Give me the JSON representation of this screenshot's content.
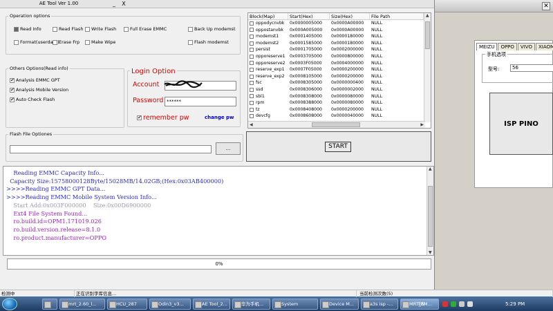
{
  "window": {
    "title": "AE Tool Ver 1.00",
    "minimize": "_",
    "close": "X"
  },
  "operation_options": {
    "legend": "Operation options",
    "items": [
      {
        "label": "Read Info",
        "state": "filled"
      },
      {
        "label": "Read Flash",
        "state": "unchecked"
      },
      {
        "label": "Write Flash",
        "state": "unchecked"
      },
      {
        "label": "Full Erase EMMC",
        "state": "unchecked"
      },
      {
        "label": "Back Up modemst",
        "state": "unchecked"
      },
      {
        "label": "Format(userdata)",
        "state": "unchecked"
      },
      {
        "label": "Erase Frp",
        "state": "unchecked"
      },
      {
        "label": "Make Wipe",
        "state": "unchecked"
      },
      {
        "label": "Flash modemst",
        "state": "unchecked"
      }
    ]
  },
  "other_options": {
    "legend": "Others Options(Read info)",
    "items": [
      {
        "label": "Analysis EMMC GPT",
        "checked": true
      },
      {
        "label": "Analysis Mobile Version",
        "checked": true
      },
      {
        "label": "Auto Check Flash",
        "checked": true
      }
    ]
  },
  "login": {
    "title": "Login Option",
    "account_label": "Account",
    "account_value": "",
    "password_label": "Password",
    "password_value": "******",
    "remember_label": "remember pw",
    "remember_checked": true,
    "change_pw": "change pw"
  },
  "flash_file": {
    "legend": "Flash File Optiones",
    "path_value": "",
    "browse_label": "..."
  },
  "table": {
    "headers": [
      "Block(Map)",
      "Start(Hex)",
      "Size(Hex)",
      "File Path"
    ],
    "rows": [
      [
        "oppodycnvbk",
        "0x0000005000",
        "0x0000A00000",
        "NULL"
      ],
      [
        "oppostanvbk",
        "0x000A005000",
        "0x0000A00000",
        "NULL"
      ],
      [
        "modemst1",
        "0x0001405000",
        "0x0000180000",
        "NULL"
      ],
      [
        "modemst2",
        "0x0001585000",
        "0x0000180000",
        "NULL"
      ],
      [
        "persist",
        "0x0001705000",
        "0x0002000000",
        "NULL"
      ],
      [
        "opporeserve1",
        "0x0003705000",
        "0x0000800000",
        "NULL"
      ],
      [
        "opporeserve2",
        "0x0003F05000",
        "0x0004000000",
        "NULL"
      ],
      [
        "reserve_exp1",
        "0x0007F05000",
        "0x0000200000",
        "NULL"
      ],
      [
        "reserve_exp2",
        "0x0008105000",
        "0x0000200000",
        "NULL"
      ],
      [
        "fsc",
        "0x0008305000",
        "0x0000000400",
        "NULL"
      ],
      [
        "ssd",
        "0x0008306000",
        "0x0000002000",
        "NULL"
      ],
      [
        "sbl1",
        "0x0008308000",
        "0x0000080000",
        "NULL"
      ],
      [
        "rpm",
        "0x0008388000",
        "0x0000080000",
        "NULL"
      ],
      [
        "tz",
        "0x0008408000",
        "0x0000200000",
        "NULL"
      ],
      [
        "devcfg",
        "0x0008608000",
        "0x0000040000",
        "NULL"
      ]
    ]
  },
  "start_label": "START",
  "log": {
    "lines": [
      {
        "text": "    Reading EMMC Capacity Info...",
        "color": "#2a2ad0"
      },
      {
        "text": "  Capacity Size:15758000128Byte/15028MB/14.02GB;(Hex:0x03AB400000)",
        "color": "#2a2ad0"
      },
      {
        "text": ">>>>Reading EMMC GPT Data...",
        "color": "#2a2ad0"
      },
      {
        "text": ">>>>Reading EMMC Mobile System Version Info...",
        "color": "#2a2ad0"
      },
      {
        "text": "    Start Add:0x003F000000    Size:0x00D6900000",
        "color": "#9a9aa8"
      },
      {
        "text": "    Ext4 File System Found...",
        "color": "#a020c0"
      },
      {
        "text": "    ro.build.id=OPM1.171019.026",
        "color": "#a020c0"
      },
      {
        "text": "    ro.build.version.release=8.1.0",
        "color": "#a020c0"
      },
      {
        "text": "    ro.product.manufacturer=OPPO",
        "color": "#a020c0"
      }
    ]
  },
  "progress": {
    "text": "0%",
    "value": 0
  },
  "status": {
    "s1": "检测中",
    "s2": "正在识别字库信息...",
    "s3": "当前检测次数(5)"
  },
  "right_window": {
    "tabs": [
      "MEIZU",
      "OPPO",
      "VIVO",
      "XIAOMI"
    ],
    "group_title": "手机选项",
    "model_label": "型号:",
    "model_value": "56",
    "isp_label": "ISP PINO"
  },
  "taskbar": {
    "tasks": [
      "mrt_2.60_l...",
      "HCU_287",
      "Odin3_v3...",
      "AE Tool_2...",
      "华为手机...",
      "System",
      "Device M...",
      "a3s isp -...",
      "MRT_EM..."
    ],
    "active_index": 8,
    "lang": "EN",
    "time": "5:29 PM"
  }
}
